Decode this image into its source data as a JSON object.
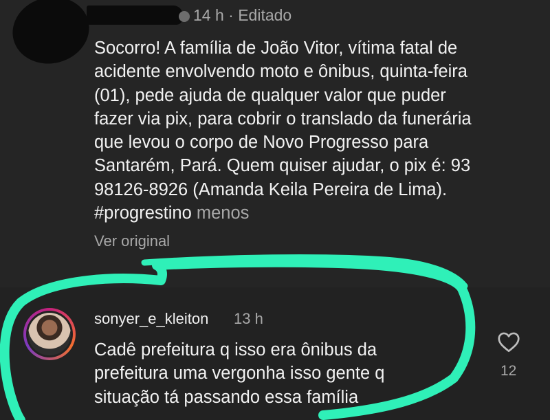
{
  "post": {
    "time": "14 h",
    "separator": " · ",
    "edited": "Editado",
    "lines": [
      "Socorro! A família de João Vitor, vítima fatal de",
      "acidente envolvendo moto e ônibus, quinta-feira",
      "(01), pede ajuda de qualquer valor que puder",
      "fazer via pix, para cobrir o translado da funerária",
      "que levou o corpo de Novo Progresso para",
      "Santarém, Pará. Quem quiser ajudar, o pix é: 93",
      "98126-8926 (Amanda Keila Pereira de Lima)."
    ],
    "hashtag": "#progrestino",
    "less_label": "menos",
    "see_original": "Ver original"
  },
  "reply": {
    "username": "sonyer_e_kleiton",
    "time": "13 h",
    "lines": [
      "Cadê prefeitura q isso era ônibus da",
      "prefeitura uma vergonha isso gente q",
      "situação tá passando essa família"
    ],
    "like_icon": "heart-outline-icon",
    "likes": "12"
  },
  "colors": {
    "background": "#252525",
    "text": "#f2f2f2",
    "muted_text": "#a8a8a8",
    "highlight_marker": "#2ff0b8",
    "redaction": "#0b0b0b"
  }
}
